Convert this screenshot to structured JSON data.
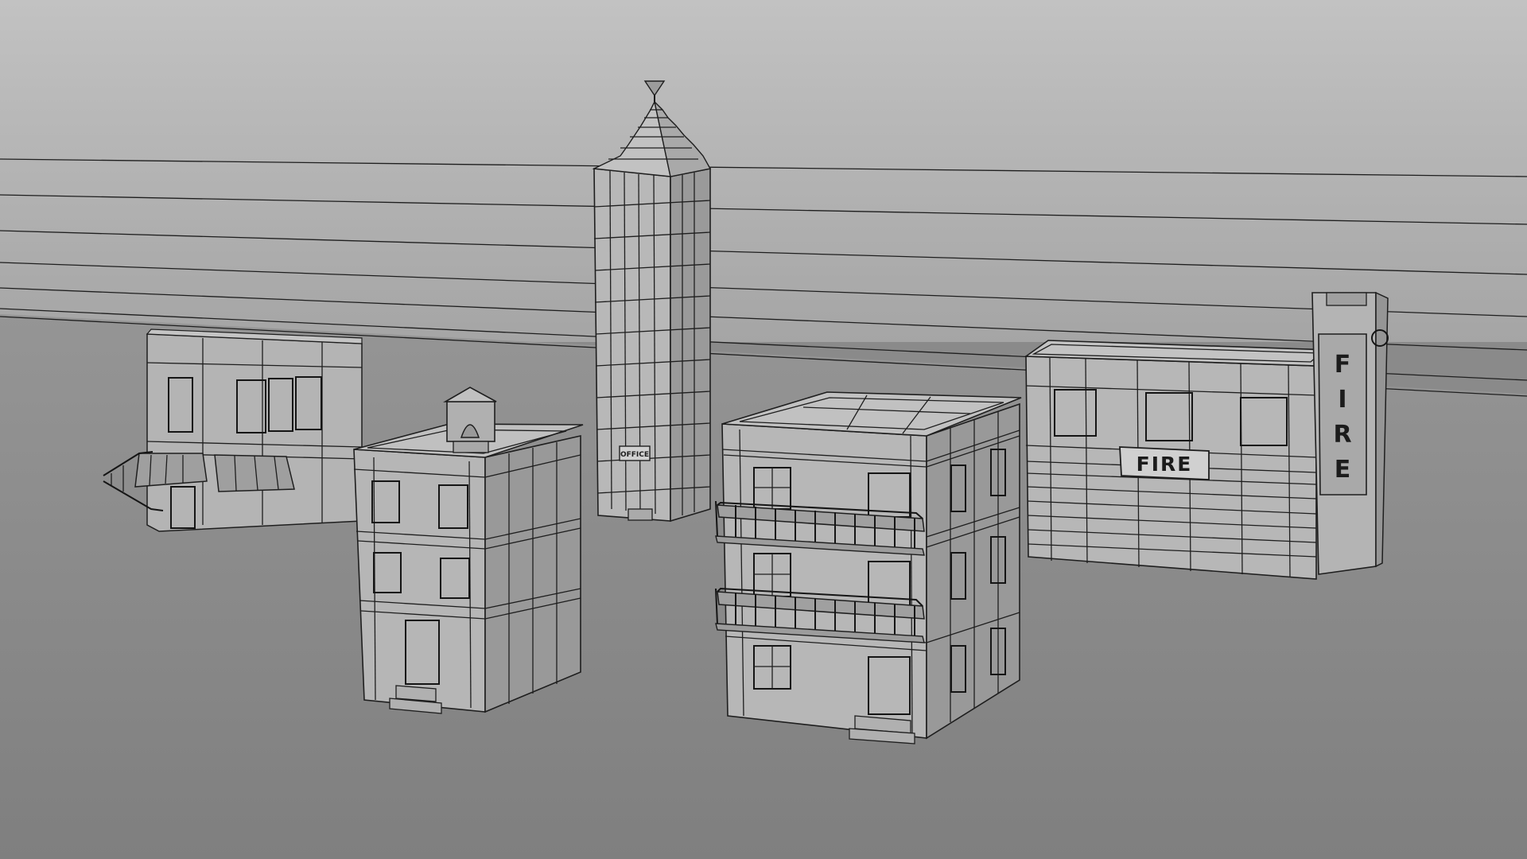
{
  "viewport": {
    "colors": {
      "backdrop_top": "#bdbdbd",
      "backdrop_bottom": "#a7a7a7",
      "floor": "#8b8b8b",
      "face_light": "#b9b9b9",
      "face_mid": "#a2a2a2",
      "face_dark": "#8e8e8e",
      "wire": "#1e1e1e"
    }
  },
  "scene": {
    "buildings": [
      {
        "name": "corner-shop"
      },
      {
        "name": "bell-tower-house"
      },
      {
        "name": "office-tower",
        "sign": "OFFICE"
      },
      {
        "name": "apartment-block"
      },
      {
        "name": "fire-station",
        "sign_front": "FIRE",
        "sign_vertical": "FIRE"
      }
    ]
  }
}
